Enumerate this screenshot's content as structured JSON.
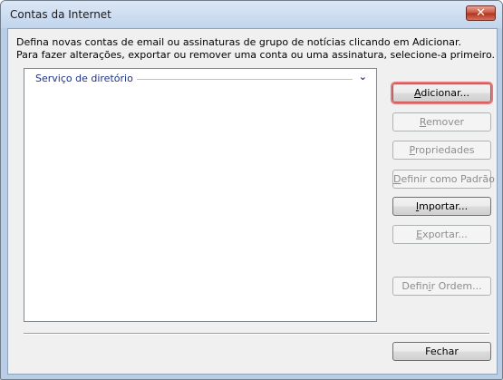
{
  "window": {
    "title": "Contas da Internet",
    "close_label": "✕"
  },
  "instructions": {
    "line1": "Defina novas contas de email ou assinaturas de grupo de notícias clicando em Adicionar.",
    "line2": "Para fazer alterações, exportar ou remover uma conta ou uma assinatura, selecione-a primeiro."
  },
  "list": {
    "group_label": "Serviço de diretório",
    "chevron": "⌄"
  },
  "buttons": {
    "add": {
      "mnemonic": "A",
      "rest": "dicionar..."
    },
    "remove": {
      "mnemonic": "R",
      "rest": "emover"
    },
    "properties": {
      "mnemonic": "P",
      "rest": "ropriedades"
    },
    "set_default": {
      "mnemonic": "D",
      "rest": "efinir como Padrão"
    },
    "import": {
      "mnemonic": "I",
      "rest": "mportar..."
    },
    "export": {
      "mnemonic": "E",
      "rest": "xportar..."
    },
    "set_order": {
      "pre": "Defin",
      "mnemonic": "i",
      "rest": "r Ordem..."
    },
    "close": "Fechar"
  }
}
